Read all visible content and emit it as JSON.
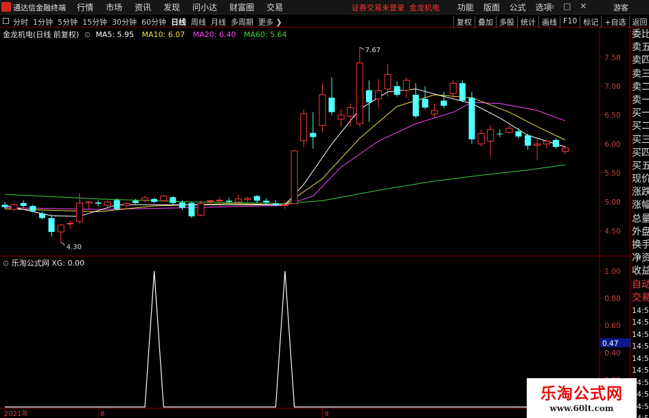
{
  "menubar": {
    "app_title": "通达信金融终端",
    "menus": [
      "行情",
      "市场",
      "资讯",
      "发现",
      "问小达",
      "财富圈",
      "交易"
    ],
    "status_text": "证券交易未登录",
    "stock_name": "金龙机电",
    "right_menus": [
      "功能",
      "版面",
      "公式",
      "选项"
    ],
    "window_icons": [
      "minimize-icon",
      "maximize-icon",
      "close-icon"
    ],
    "guest": "游客"
  },
  "toolbar": {
    "periods": [
      "分时",
      "1分钟",
      "5分钟",
      "15分钟",
      "30分钟",
      "60分钟",
      "日线",
      "周线",
      "月线",
      "多周期",
      "更多"
    ],
    "active_period": "日线",
    "right_buttons": [
      "复权",
      "叠加",
      "多股",
      "统计",
      "画线",
      "F10",
      "标记",
      "+自选",
      "返回"
    ]
  },
  "kline_info": {
    "symbol": "金龙机电(日线 前复权)",
    "ma5": "MA5: 5.95",
    "ma10": "MA10: 6.07",
    "ma20": "MA20: 6.40",
    "ma60": "MA60: 5.64"
  },
  "xg_info": "乐淘公式网 XG: 0.00",
  "price_axis": [
    "7.50",
    "7.00",
    "6.50",
    "6.00",
    "5.50",
    "5.00",
    "4.50"
  ],
  "xg_axis": [
    "1.00",
    "0.80",
    "0.60",
    "0.40",
    "0.20"
  ],
  "annotations": {
    "high": "7.67",
    "low": "4.30"
  },
  "crosshair_value": "0.47",
  "date_axis": [
    "2021年",
    "8",
    "9"
  ],
  "right_panel": {
    "quote_labels": [
      "委比",
      "卖五",
      "卖四",
      "卖三",
      "卖二",
      "卖一",
      "买一",
      "买二",
      "买三",
      "买四",
      "买五",
      "现价",
      "涨跌",
      "涨幅",
      "总量",
      "外盘",
      "换手",
      "净资",
      "收益"
    ],
    "trade_labels": [
      "自动",
      "交易"
    ],
    "times": [
      "14:56",
      "14:56",
      "14:56",
      "14:56",
      "14:56",
      "14:56",
      "14:56",
      "14:56",
      "14:56",
      "14:56"
    ]
  },
  "watermark": {
    "title": "乐淘公式网",
    "url": "www.60lt.com"
  },
  "colors": {
    "up": "#ff3a3a",
    "down": "#54ffff",
    "ma5": "#ffffff",
    "ma10": "#f2e14a",
    "ma20": "#ff45ff",
    "ma60": "#3cd13c",
    "xg": "#ffffff",
    "frame": "#8a0000"
  },
  "chart_data": {
    "type": "candlestick",
    "price_ylim": [
      4.1,
      7.8
    ],
    "xg_ylim": [
      0,
      1.05
    ],
    "candles": [
      {
        "o": 4.95,
        "h": 5.0,
        "l": 4.88,
        "c": 4.91
      },
      {
        "o": 4.87,
        "h": 4.97,
        "l": 4.85,
        "c": 4.95
      },
      {
        "o": 4.98,
        "h": 5.03,
        "l": 4.9,
        "c": 4.93
      },
      {
        "o": 4.93,
        "h": 4.95,
        "l": 4.82,
        "c": 4.84
      },
      {
        "o": 4.8,
        "h": 4.83,
        "l": 4.7,
        "c": 4.72
      },
      {
        "o": 4.72,
        "h": 4.78,
        "l": 4.4,
        "c": 4.48
      },
      {
        "o": 4.48,
        "h": 4.62,
        "l": 4.3,
        "c": 4.6
      },
      {
        "o": 4.62,
        "h": 4.68,
        "l": 4.53,
        "c": 4.63
      },
      {
        "o": 4.66,
        "h": 5.15,
        "l": 4.62,
        "c": 4.98
      },
      {
        "o": 4.98,
        "h": 5.02,
        "l": 4.88,
        "c": 5.0
      },
      {
        "o": 4.99,
        "h": 5.03,
        "l": 4.93,
        "c": 4.97
      },
      {
        "o": 4.94,
        "h": 5.02,
        "l": 4.91,
        "c": 5.0
      },
      {
        "o": 5.03,
        "h": 5.06,
        "l": 4.85,
        "c": 4.88
      },
      {
        "o": 4.94,
        "h": 5.0,
        "l": 4.9,
        "c": 4.97
      },
      {
        "o": 5.02,
        "h": 5.05,
        "l": 4.96,
        "c": 4.98
      },
      {
        "o": 5.03,
        "h": 5.1,
        "l": 4.99,
        "c": 5.07
      },
      {
        "o": 5.05,
        "h": 5.07,
        "l": 4.98,
        "c": 5.0
      },
      {
        "o": 5.02,
        "h": 5.12,
        "l": 5.0,
        "c": 5.1
      },
      {
        "o": 5.08,
        "h": 5.1,
        "l": 4.95,
        "c": 4.98
      },
      {
        "o": 4.99,
        "h": 5.03,
        "l": 4.86,
        "c": 4.9
      },
      {
        "o": 4.98,
        "h": 5.0,
        "l": 4.72,
        "c": 4.75
      },
      {
        "o": 4.77,
        "h": 5.02,
        "l": 4.75,
        "c": 4.97
      },
      {
        "o": 5.01,
        "h": 5.04,
        "l": 4.95,
        "c": 5.02
      },
      {
        "o": 5.03,
        "h": 5.08,
        "l": 4.98,
        "c": 5.03
      },
      {
        "o": 5.02,
        "h": 5.07,
        "l": 4.98,
        "c": 5.0
      },
      {
        "o": 5.0,
        "h": 5.12,
        "l": 4.96,
        "c": 5.05
      },
      {
        "o": 5.04,
        "h": 5.09,
        "l": 4.98,
        "c": 5.06
      },
      {
        "o": 5.1,
        "h": 5.12,
        "l": 4.98,
        "c": 5.02
      },
      {
        "o": 5.02,
        "h": 5.06,
        "l": 4.95,
        "c": 4.99
      },
      {
        "o": 4.97,
        "h": 5.03,
        "l": 4.92,
        "c": 4.94
      },
      {
        "o": 4.95,
        "h": 5.01,
        "l": 4.88,
        "c": 4.95
      },
      {
        "o": 4.97,
        "h": 5.9,
        "l": 4.97,
        "c": 5.88
      },
      {
        "o": 6.06,
        "h": 6.6,
        "l": 5.95,
        "c": 6.52
      },
      {
        "o": 6.19,
        "h": 6.55,
        "l": 5.92,
        "c": 6.12
      },
      {
        "o": 6.32,
        "h": 7.05,
        "l": 6.2,
        "c": 6.85
      },
      {
        "o": 6.8,
        "h": 7.15,
        "l": 6.5,
        "c": 6.55
      },
      {
        "o": 6.43,
        "h": 6.6,
        "l": 6.3,
        "c": 6.5
      },
      {
        "o": 6.48,
        "h": 6.7,
        "l": 6.3,
        "c": 6.63
      },
      {
        "o": 6.35,
        "h": 7.67,
        "l": 6.3,
        "c": 7.4
      },
      {
        "o": 6.93,
        "h": 7.1,
        "l": 6.38,
        "c": 6.72
      },
      {
        "o": 6.78,
        "h": 7.12,
        "l": 6.62,
        "c": 6.92
      },
      {
        "o": 6.95,
        "h": 7.38,
        "l": 6.82,
        "c": 7.2
      },
      {
        "o": 7.0,
        "h": 7.08,
        "l": 6.82,
        "c": 6.85
      },
      {
        "o": 6.93,
        "h": 7.15,
        "l": 6.8,
        "c": 7.1
      },
      {
        "o": 6.85,
        "h": 7.05,
        "l": 6.45,
        "c": 6.48
      },
      {
        "o": 6.78,
        "h": 7.0,
        "l": 6.6,
        "c": 6.63
      },
      {
        "o": 6.52,
        "h": 6.7,
        "l": 6.45,
        "c": 6.58
      },
      {
        "o": 6.75,
        "h": 6.9,
        "l": 6.62,
        "c": 6.66
      },
      {
        "o": 6.87,
        "h": 7.1,
        "l": 6.78,
        "c": 7.05
      },
      {
        "o": 7.05,
        "h": 7.1,
        "l": 6.72,
        "c": 6.75
      },
      {
        "o": 6.8,
        "h": 6.9,
        "l": 6.0,
        "c": 6.08
      },
      {
        "o": 6.0,
        "h": 6.25,
        "l": 5.95,
        "c": 6.18
      },
      {
        "o": 6.05,
        "h": 6.32,
        "l": 5.78,
        "c": 6.25
      },
      {
        "o": 6.18,
        "h": 6.25,
        "l": 6.12,
        "c": 6.17
      },
      {
        "o": 6.2,
        "h": 6.32,
        "l": 6.18,
        "c": 6.27
      },
      {
        "o": 6.22,
        "h": 6.28,
        "l": 6.1,
        "c": 6.13
      },
      {
        "o": 6.15,
        "h": 6.18,
        "l": 5.9,
        "c": 5.97
      },
      {
        "o": 5.98,
        "h": 6.1,
        "l": 5.72,
        "c": 6.0
      },
      {
        "o": 6.0,
        "h": 6.08,
        "l": 5.92,
        "c": 6.05
      },
      {
        "o": 6.07,
        "h": 6.1,
        "l": 5.92,
        "c": 5.95
      },
      {
        "o": 5.87,
        "h": 5.98,
        "l": 5.82,
        "c": 5.93
      }
    ],
    "ma5": [
      [
        0,
        4.94
      ],
      [
        5,
        4.76
      ],
      [
        8,
        4.75
      ],
      [
        12,
        4.95
      ],
      [
        20,
        4.95
      ],
      [
        30,
        4.95
      ],
      [
        32,
        5.3
      ],
      [
        35,
        6.0
      ],
      [
        38,
        6.6
      ],
      [
        41,
        6.9
      ],
      [
        44,
        6.95
      ],
      [
        47,
        6.82
      ],
      [
        50,
        6.7
      ],
      [
        53,
        6.45
      ],
      [
        56,
        6.15
      ],
      [
        60,
        5.95
      ]
    ],
    "ma10": [
      [
        0,
        4.88
      ],
      [
        6,
        4.85
      ],
      [
        10,
        4.83
      ],
      [
        16,
        4.93
      ],
      [
        24,
        4.97
      ],
      [
        30,
        4.95
      ],
      [
        34,
        5.4
      ],
      [
        38,
        6.1
      ],
      [
        42,
        6.65
      ],
      [
        46,
        6.85
      ],
      [
        50,
        6.8
      ],
      [
        54,
        6.55
      ],
      [
        57,
        6.3
      ],
      [
        60,
        6.07
      ]
    ],
    "ma20": [
      [
        0,
        4.9
      ],
      [
        10,
        4.87
      ],
      [
        20,
        4.9
      ],
      [
        30,
        4.94
      ],
      [
        33,
        5.1
      ],
      [
        36,
        5.6
      ],
      [
        40,
        6.05
      ],
      [
        44,
        6.35
      ],
      [
        48,
        6.55
      ],
      [
        50,
        6.72
      ],
      [
        53,
        6.7
      ],
      [
        57,
        6.58
      ],
      [
        60,
        6.4
      ]
    ],
    "ma60": [
      [
        0,
        5.13
      ],
      [
        10,
        5.05
      ],
      [
        20,
        5.0
      ],
      [
        30,
        4.97
      ],
      [
        34,
        5.02
      ],
      [
        40,
        5.2
      ],
      [
        46,
        5.36
      ],
      [
        52,
        5.48
      ],
      [
        56,
        5.55
      ],
      [
        60,
        5.64
      ]
    ],
    "xg_signals": [
      16,
      30
    ]
  }
}
